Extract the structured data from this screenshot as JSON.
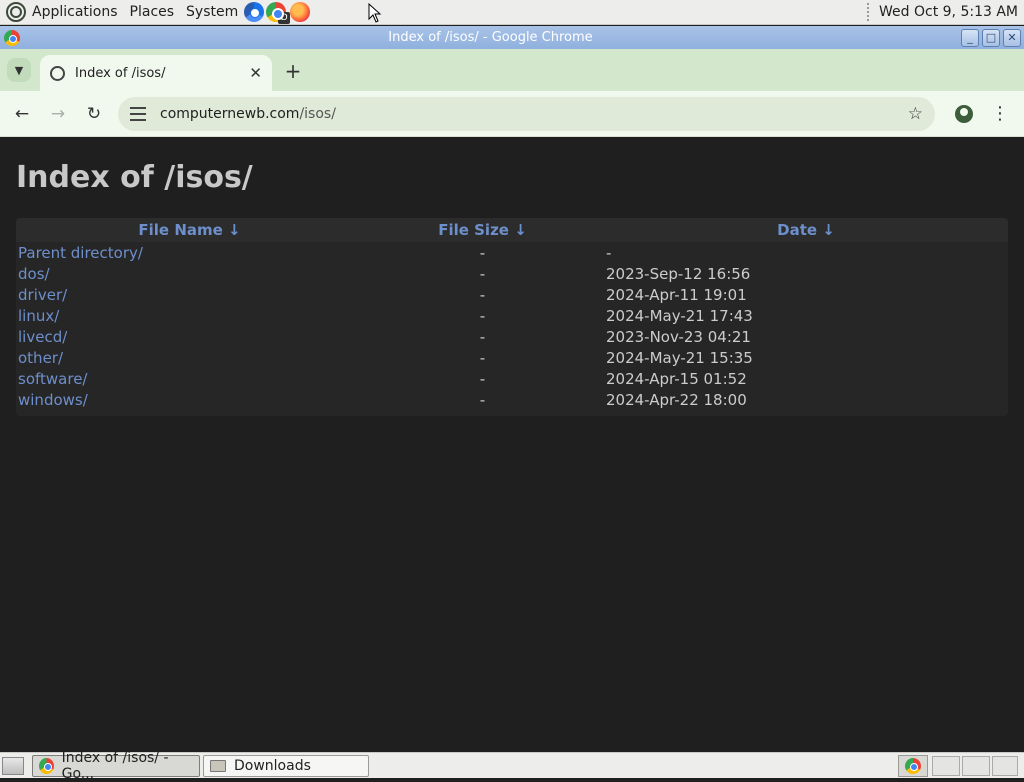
{
  "top_panel": {
    "menus": [
      "Applications",
      "Places",
      "System"
    ],
    "launchers": [
      "chromium-icon",
      "chrome-dev-icon",
      "firefox-icon"
    ],
    "chrome_dev_badge": "D",
    "clock": "Wed Oct  9,  5:13 AM"
  },
  "window": {
    "title": "Index of /isos/ - Google Chrome",
    "controls": [
      "minimize",
      "maximize",
      "close"
    ]
  },
  "browser": {
    "tab_title": "Index of /isos/",
    "tab_close": "✕",
    "new_tab": "+",
    "url_host": "computernewb.com",
    "url_path": "/isos/",
    "colors": {
      "tabstrip": "#d3e7cd",
      "toolbar": "#f1f8ee",
      "omnibox": "#dfead9"
    }
  },
  "page": {
    "heading": "Index of /isos/",
    "columns": [
      "File Name  ↓",
      "File Size  ↓",
      "Date  ↓"
    ],
    "rows": [
      {
        "name": "Parent directory/",
        "size": "-",
        "date": "-"
      },
      {
        "name": "dos/",
        "size": "-",
        "date": "2023-Sep-12 16:56"
      },
      {
        "name": "driver/",
        "size": "-",
        "date": "2024-Apr-11 19:01"
      },
      {
        "name": "linux/",
        "size": "-",
        "date": "2024-May-21 17:43"
      },
      {
        "name": "livecd/",
        "size": "-",
        "date": "2023-Nov-23 04:21"
      },
      {
        "name": "other/",
        "size": "-",
        "date": "2024-May-21 15:35"
      },
      {
        "name": "software/",
        "size": "-",
        "date": "2024-Apr-15 01:52"
      },
      {
        "name": "windows/",
        "size": "-",
        "date": "2024-Apr-22 18:00"
      }
    ],
    "colors": {
      "background": "#1f1f1f",
      "link": "#6d8fcb",
      "text": "#cccccc"
    }
  },
  "taskbar": {
    "tasks": [
      {
        "label": "Index of /isos/ - Go...",
        "icon": "chrome-icon",
        "active": true
      },
      {
        "label": "Downloads",
        "icon": "folder-icon",
        "active": false
      }
    ]
  }
}
